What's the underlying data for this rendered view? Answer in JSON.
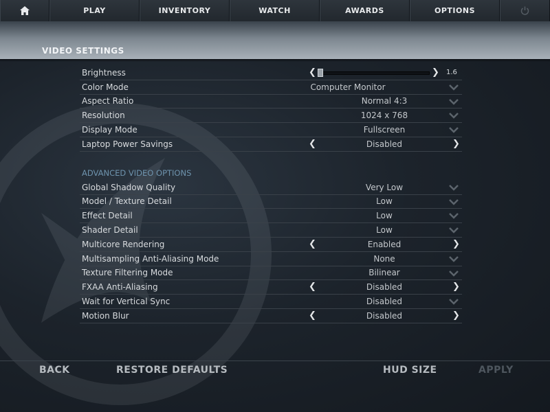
{
  "nav": {
    "items": [
      {
        "id": "play",
        "label": "PLAY"
      },
      {
        "id": "inventory",
        "label": "INVENTORY"
      },
      {
        "id": "watch",
        "label": "WATCH"
      },
      {
        "id": "awards",
        "label": "AWARDS"
      },
      {
        "id": "options",
        "label": "OPTIONS"
      }
    ],
    "icons": {
      "home": "home-icon",
      "power": "power-icon"
    }
  },
  "page": {
    "title": "VIDEO SETTINGS"
  },
  "settings": {
    "brightness": {
      "label": "Brightness",
      "value": "1.6",
      "slider_level_percent": 0
    },
    "basic": [
      {
        "label": "Color Mode",
        "value": "Computer Monitor",
        "control": "dropdown"
      },
      {
        "label": "Aspect Ratio",
        "value": "Normal 4:3",
        "control": "dropdown"
      },
      {
        "label": "Resolution",
        "value": "1024 x 768",
        "control": "dropdown"
      },
      {
        "label": "Display Mode",
        "value": "Fullscreen",
        "control": "dropdown"
      },
      {
        "label": "Laptop Power Savings",
        "value": "Disabled",
        "control": "cycle"
      }
    ],
    "advanced_title": "ADVANCED VIDEO OPTIONS",
    "advanced": [
      {
        "label": "Global Shadow Quality",
        "value": "Very Low",
        "control": "dropdown"
      },
      {
        "label": "Model / Texture Detail",
        "value": "Low",
        "control": "dropdown"
      },
      {
        "label": "Effect Detail",
        "value": "Low",
        "control": "dropdown"
      },
      {
        "label": "Shader Detail",
        "value": "Low",
        "control": "dropdown"
      },
      {
        "label": "Multicore Rendering",
        "value": "Enabled",
        "control": "cycle"
      },
      {
        "label": "Multisampling Anti-Aliasing Mode",
        "value": "None",
        "control": "dropdown"
      },
      {
        "label": "Texture Filtering Mode",
        "value": "Bilinear",
        "control": "dropdown"
      },
      {
        "label": "FXAA Anti-Aliasing",
        "value": "Disabled",
        "control": "cycle"
      },
      {
        "label": "Wait for Vertical Sync",
        "value": "Disabled",
        "control": "dropdown"
      },
      {
        "label": "Motion Blur",
        "value": "Disabled",
        "control": "cycle"
      }
    ]
  },
  "footer": {
    "back": "BACK",
    "restore": "RESTORE DEFAULTS",
    "hud_size": "HUD SIZE",
    "apply": "APPLY"
  },
  "colors": {
    "accent_section": "#6e93ad",
    "header_band": "#a8b0b8",
    "disabled_text": "#4e565e"
  }
}
